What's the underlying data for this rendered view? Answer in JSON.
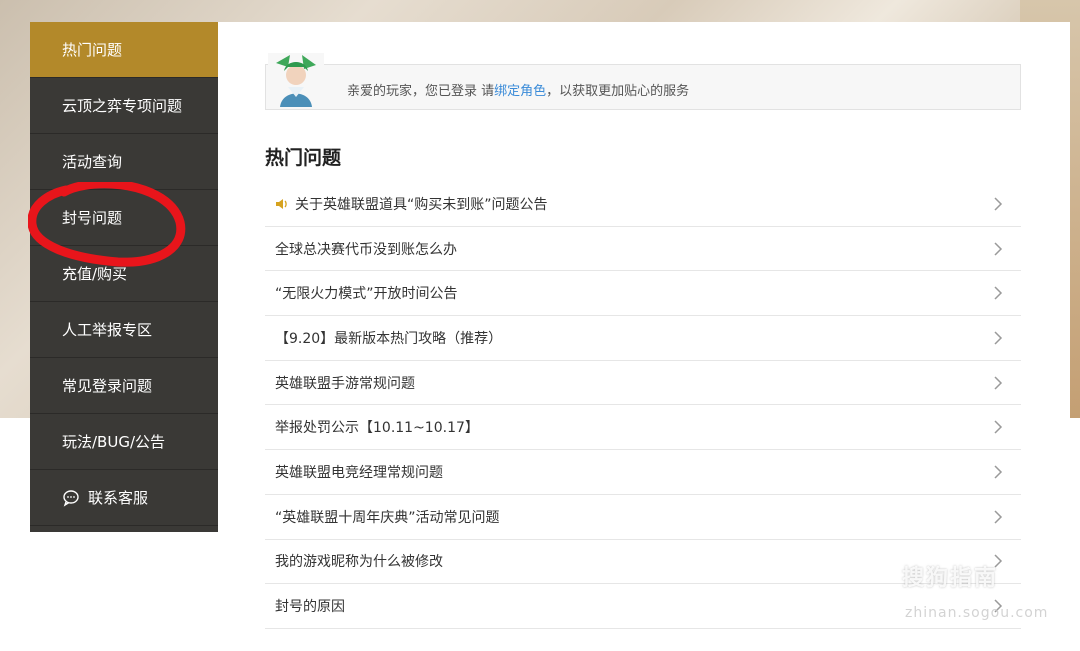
{
  "sidebar": {
    "items": [
      {
        "label": "热门问题",
        "active": true
      },
      {
        "label": "云顶之弈专项问题"
      },
      {
        "label": "活动查询"
      },
      {
        "label": "封号问题"
      },
      {
        "label": "充值/购买"
      },
      {
        "label": "人工举报专区"
      },
      {
        "label": "常见登录问题"
      },
      {
        "label": "玩法/BUG/公告"
      },
      {
        "label": "联系客服",
        "icon": "chat-bubble-icon"
      }
    ]
  },
  "notice": {
    "prefix": "亲爱的玩家，您已登录 请",
    "link": "绑定角色",
    "suffix": "，以获取更加贴心的服务"
  },
  "section_title": "热门问题",
  "questions": [
    {
      "text": "关于英雄联盟道具“购买未到账”问题公告",
      "icon": "speaker-icon"
    },
    {
      "text": "全球总决赛代币没到账怎么办"
    },
    {
      "text": "“无限火力模式”开放时间公告"
    },
    {
      "text": "【9.20】最新版本热门攻略（推荐）"
    },
    {
      "text": "英雄联盟手游常规问题"
    },
    {
      "text": "举报处罚公示【10.11~10.17】"
    },
    {
      "text": "英雄联盟电竞经理常规问题"
    },
    {
      "text": "“英雄联盟十周年庆典”活动常见问题"
    },
    {
      "text": "我的游戏昵称为什么被修改"
    },
    {
      "text": "封号的原因"
    }
  ],
  "watermark": {
    "main": "搜狗指南",
    "sub": "zhinan.sogou.com"
  },
  "colors": {
    "active": "#b3892a",
    "sidebar": "#3a3936",
    "link": "#3a8bd8",
    "annotation": "#e8151b"
  }
}
